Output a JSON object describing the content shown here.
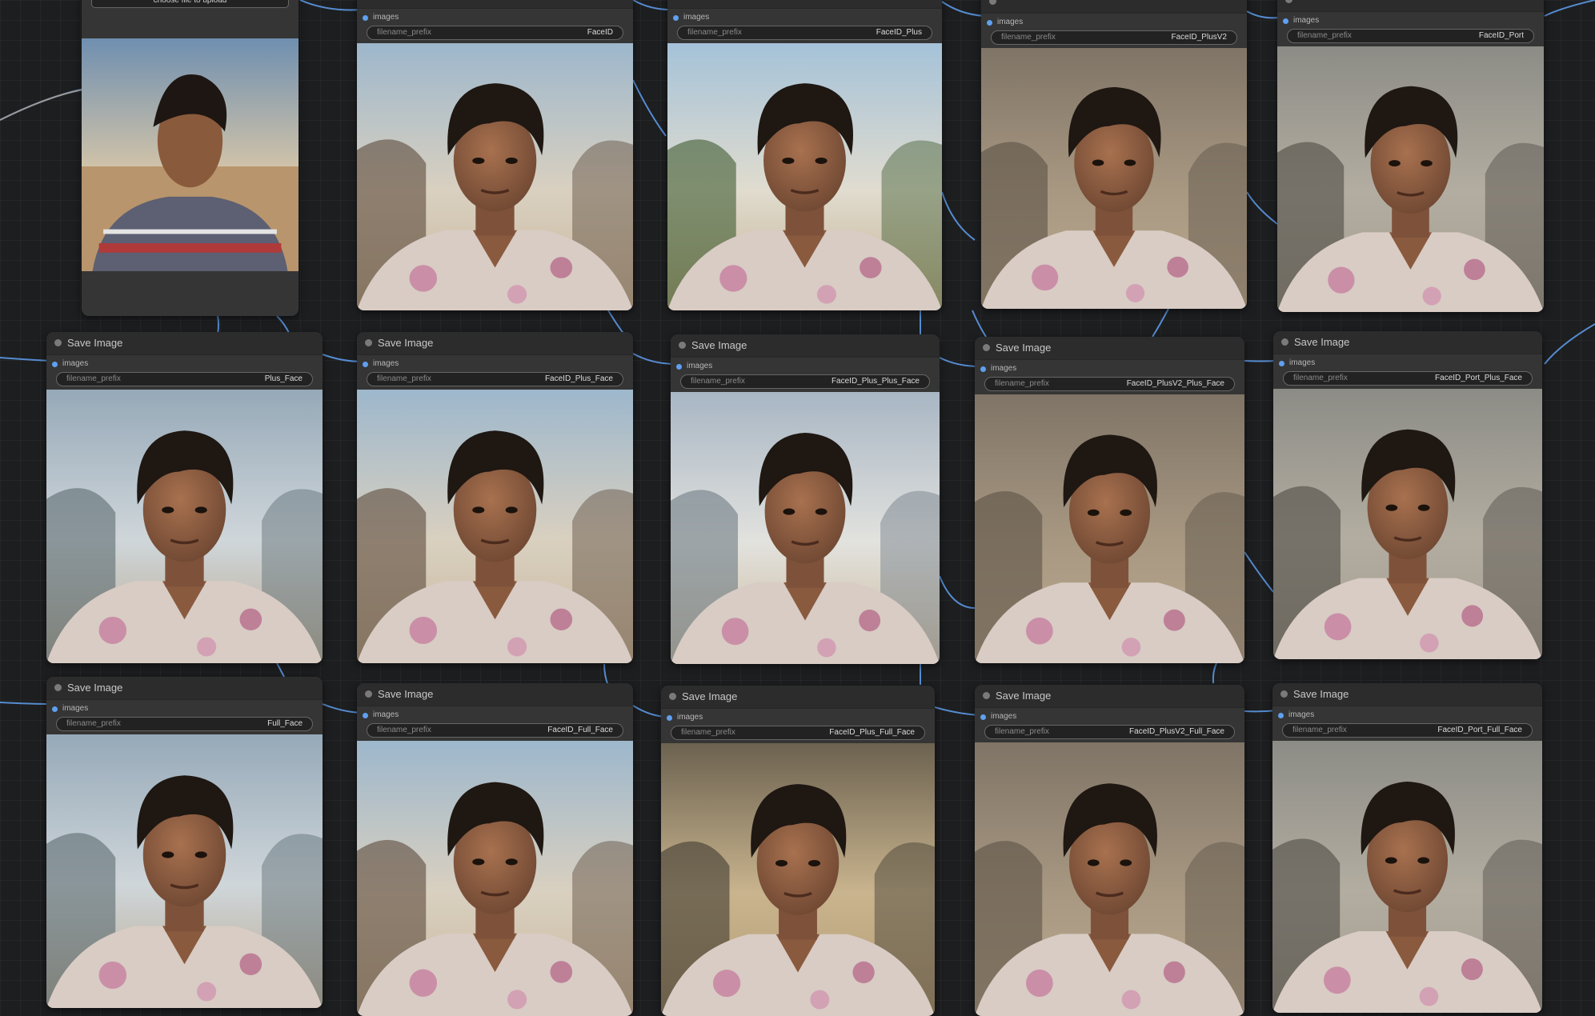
{
  "load_node": {
    "upload_label": "choose file to upload"
  },
  "nodes": [
    {
      "title": "",
      "input": "images",
      "widget": "filename_prefix",
      "value": "FaceID"
    },
    {
      "title": "",
      "input": "images",
      "widget": "filename_prefix",
      "value": "FaceID_Plus"
    },
    {
      "title": "",
      "input": "images",
      "widget": "filename_prefix",
      "value": "FaceID_PlusV2"
    },
    {
      "title": "",
      "input": "images",
      "widget": "filename_prefix",
      "value": "FaceID_Port"
    },
    {
      "title": "Save Image",
      "input": "images",
      "widget": "filename_prefix",
      "value": "Plus_Face"
    },
    {
      "title": "Save Image",
      "input": "images",
      "widget": "filename_prefix",
      "value": "FaceID_Plus_Face"
    },
    {
      "title": "Save Image",
      "input": "images",
      "widget": "filename_prefix",
      "value": "FaceID_Plus_Plus_Face"
    },
    {
      "title": "Save Image",
      "input": "images",
      "widget": "filename_prefix",
      "value": "FaceID_PlusV2_Plus_Face"
    },
    {
      "title": "Save Image",
      "input": "images",
      "widget": "filename_prefix",
      "value": "FaceID_Port_Plus_Face"
    },
    {
      "title": "Save Image",
      "input": "images",
      "widget": "filename_prefix",
      "value": "Full_Face"
    },
    {
      "title": "Save Image",
      "input": "images",
      "widget": "filename_prefix",
      "value": "FaceID_Full_Face"
    },
    {
      "title": "Save Image",
      "input": "images",
      "widget": "filename_prefix",
      "value": "FaceID_Plus_Full_Face"
    },
    {
      "title": "Save Image",
      "input": "images",
      "widget": "filename_prefix",
      "value": "FaceID_PlusV2_Full_Face"
    },
    {
      "title": "Save Image",
      "input": "images",
      "widget": "filename_prefix",
      "value": "FaceID_Port_Full_Face"
    }
  ],
  "colors": {
    "link": "#5fa0f0",
    "node_body": "#353535",
    "node_header": "#2c2c2c",
    "canvas": "#1d1e20"
  },
  "icons": {
    "node_collapse": "circle-dot",
    "input_slot": "blue-dot"
  }
}
